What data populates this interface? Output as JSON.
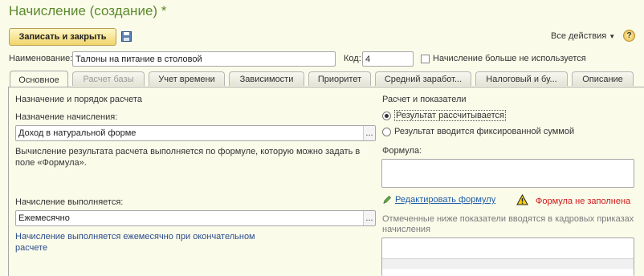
{
  "window": {
    "title": "Начисление (создание) *"
  },
  "toolbar": {
    "save_close_label": "Записать и закрыть",
    "save_icon": "floppy-disk-icon",
    "all_actions_label": "Все действия",
    "help_label": "?"
  },
  "header": {
    "name_label": "Наименование:",
    "name_value": "Талоны на питание в столовой",
    "code_label": "Код:",
    "code_value": "4",
    "unused_checkbox_label": "Начисление больше не используется",
    "unused_checked": false
  },
  "tabs": [
    {
      "label": "Основное",
      "active": true,
      "disabled": false
    },
    {
      "label": "Расчет базы",
      "active": false,
      "disabled": true
    },
    {
      "label": "Учет времени",
      "active": false,
      "disabled": false
    },
    {
      "label": "Зависимости",
      "active": false,
      "disabled": false
    },
    {
      "label": "Приоритет",
      "active": false,
      "disabled": false
    },
    {
      "label": "Средний заработ...",
      "active": false,
      "disabled": false
    },
    {
      "label": "Налоговый и бу...",
      "active": false,
      "disabled": false
    },
    {
      "label": "Описание",
      "active": false,
      "disabled": false
    }
  ],
  "left": {
    "section_title": "Назначение и порядок расчета",
    "purpose_label": "Назначение начисления:",
    "purpose_value": "Доход в натуральной форме",
    "formula_desc": "Вычисление результата расчета выполняется по формуле, которую можно задать в поле «Формула».",
    "period_label": "Начисление выполняется:",
    "period_value": "Ежемесячно",
    "period_hint": "Начисление выполняется ежемесячно при окончательном расчете",
    "choose_button": "..."
  },
  "right": {
    "section_title": "Расчет и показатели",
    "radio_calculated": "Результат рассчитывается",
    "radio_fixed": "Результат вводится фиксированной суммой",
    "selected": "calculated",
    "formula_label": "Формула:",
    "formula_value": "",
    "edit_formula_link": "Редактировать формулу",
    "formula_error": "Формула не заполнена",
    "indicators_note": "Отмеченные ниже показатели вводятся в кадровых приказах начисления"
  },
  "colors": {
    "background": "#fbfbea",
    "title": "#5a8a2c",
    "link": "#1f5ca8",
    "error": "#d01818",
    "button": "#f0d56b"
  }
}
